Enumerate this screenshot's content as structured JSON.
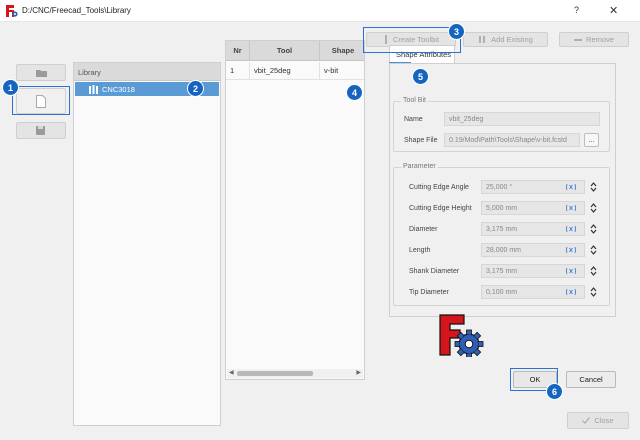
{
  "window": {
    "title": "D:/CNC/Freecad_Tools\\Library",
    "help_label": "?",
    "close_label": "✕"
  },
  "toolbar": {
    "create_toolbit_label": "Create Toolbit",
    "add_existing_label": "Add Existing",
    "remove_label": "Remove"
  },
  "side_buttons": [
    {
      "icon": "folder-open-icon"
    },
    {
      "icon": "new-document-icon"
    },
    {
      "icon": "save-as-icon"
    }
  ],
  "library": {
    "header": "Library",
    "items": [
      {
        "label": "CNC3018",
        "icon": "toolbit-library-icon"
      }
    ]
  },
  "tools_table": {
    "columns": [
      "Nr",
      "Tool",
      "Shape"
    ],
    "rows": [
      {
        "nr": "1",
        "tool": "vbit_25deg",
        "shape": "v-bit"
      }
    ]
  },
  "editor": {
    "tab_label": "Shape Attributes",
    "toolbit_group": {
      "title": "Tool Bit",
      "name_label": "Name",
      "name_value": "vbit_25deg",
      "shape_file_label": "Shape File",
      "shape_file_value": "0.19/Mod\\Path\\Tools\\Shape\\v-bit.fcstd",
      "browse_label": "..."
    },
    "parameter_group": {
      "title": "Parameter",
      "params": [
        {
          "label": "Cutting Edge Angle",
          "value": "25,000 °"
        },
        {
          "label": "Cutting Edge Height",
          "value": "5,000 mm"
        },
        {
          "label": "Diameter",
          "value": "3,175 mm"
        },
        {
          "label": "Length",
          "value": "28,000 mm"
        },
        {
          "label": "Shank Diameter",
          "value": "3,175 mm"
        },
        {
          "label": "Tip Diameter",
          "value": "0,100 mm"
        }
      ]
    }
  },
  "dialog_buttons": {
    "ok_label": "OK",
    "cancel_label": "Cancel",
    "close_label": "Close"
  },
  "callouts": [
    "1",
    "2",
    "3",
    "4",
    "5",
    "6"
  ],
  "colors": {
    "selection": "#5b9bd5",
    "callout": "#1565c0",
    "logo_red": "#d4161c",
    "logo_blue": "#2f5fb3"
  }
}
